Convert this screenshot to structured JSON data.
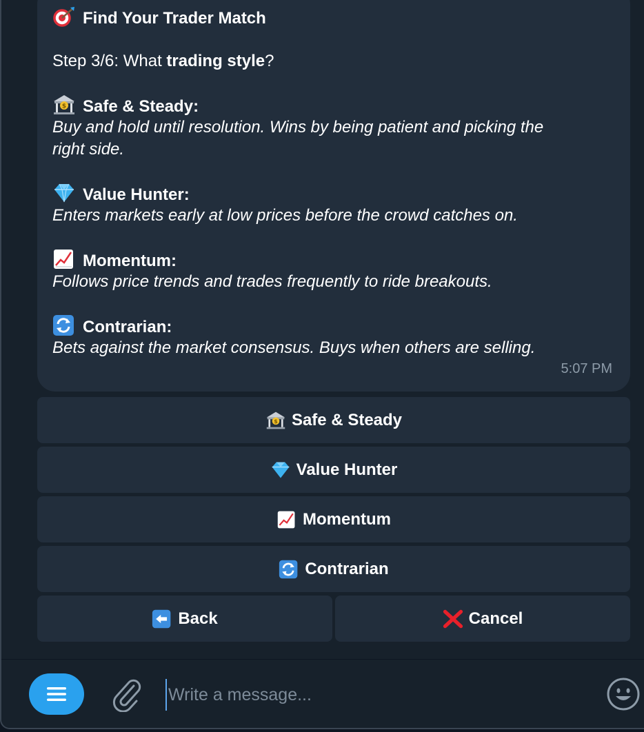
{
  "message": {
    "title": "Find Your Trader Match",
    "step_prefix": "Step 3/6: What ",
    "step_bold": "trading style",
    "step_suffix": "?",
    "options": [
      {
        "heading": "Safe & Steady:",
        "desc_lines": [
          "Buy and hold until resolution. Wins by being patient and picking the",
          "right side."
        ],
        "icon": "bank-icon"
      },
      {
        "heading": "Value Hunter:",
        "desc_lines": [
          "Enters markets early at low prices before the crowd catches on."
        ],
        "icon": "gem-icon"
      },
      {
        "heading": "Momentum:",
        "desc_lines": [
          "Follows price trends and trades frequently to ride breakouts."
        ],
        "icon": "chart-increasing-icon"
      },
      {
        "heading": "Contrarian:",
        "desc_lines": [
          "Bets against the market consensus. Buys when others are selling."
        ],
        "icon": "arrows-cycle-icon"
      }
    ],
    "time": "5:07 PM"
  },
  "keyboard": {
    "safe": "Safe & Steady",
    "value": "Value Hunter",
    "momentum": "Momentum",
    "contrarian": "Contrarian",
    "back": "Back",
    "cancel": "Cancel"
  },
  "composer": {
    "placeholder": "Write a message..."
  },
  "colors": {
    "background": "#17212b",
    "bubble": "#222e3c",
    "accent": "#2aa1ee",
    "muted_text": "#8d9ba8"
  }
}
